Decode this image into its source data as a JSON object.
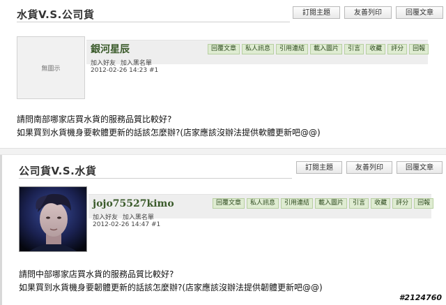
{
  "posts": [
    {
      "title": "水貨V.S.公司貨",
      "top_buttons": [
        "訂閱主題",
        "友善列印",
        "回覆文章"
      ],
      "avatar_placeholder": "無圖示",
      "username": "銀河星辰",
      "user_links": [
        "加入好友",
        "加入黑名單"
      ],
      "date": "2012-02-26 14:23 #1",
      "actions": [
        "回覆文章",
        "私人訊息",
        "引用連結",
        "載入圖片",
        "引言",
        "收藏",
        "評分",
        "回報"
      ],
      "body": [
        "請問南部哪家店買水貨的服務品質比較好?",
        "如果買到水貨機身要軟體更新的話該怎麼辦?(店家應該沒辦法提供軟體更新吧@@)"
      ]
    },
    {
      "title": "公司貨V.S.水貨",
      "top_buttons": [
        "訂閱主題",
        "友善列印",
        "回覆文章"
      ],
      "username": "jojo75527kimo",
      "user_links": [
        "加入好友",
        "加入黑名單"
      ],
      "date": "2012-02-26 14:47 #1",
      "actions": [
        "回覆文章",
        "私人訊息",
        "引用連結",
        "載入圖片",
        "引言",
        "收藏",
        "評分",
        "回報"
      ],
      "body": [
        "請問中部哪家店買水貨的服務品質比較好?",
        "如果買到水貨機身要韌體更新的話該怎麼辦?(店家應該沒辦法提供韌體更新吧@@)"
      ]
    }
  ],
  "watermark": "#2124760"
}
